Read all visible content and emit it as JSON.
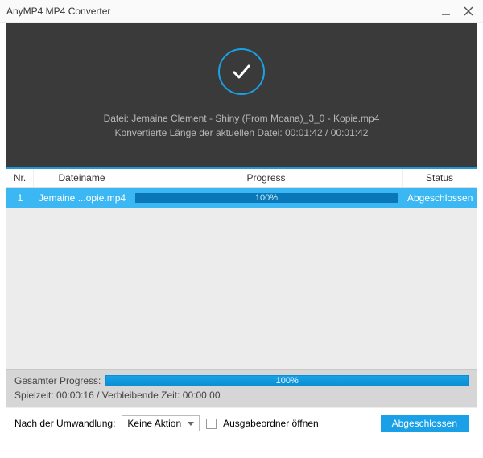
{
  "app_title": "AnyMP4 MP4 Converter",
  "hero": {
    "file_line": "Datei: Jemaine Clement - Shiny (From Moana)_3_0 - Kopie.mp4",
    "length_line": "Konvertierte Länge der aktuellen Datei: 00:01:42 / 00:01:42"
  },
  "table": {
    "headers": {
      "nr": "Nr.",
      "name": "Dateiname",
      "progress": "Progress",
      "status": "Status"
    },
    "rows": [
      {
        "nr": "1",
        "name": "Jemaine ...opie.mp4",
        "percent": "100%",
        "status": "Abgeschlossen"
      }
    ]
  },
  "summary": {
    "total_label": "Gesamter Progress:",
    "total_percent": "100%",
    "time_line": "Spielzeit: 00:00:16 / Verbleibende Zeit: 00:00:00"
  },
  "footer": {
    "after_label": "Nach der Umwandlung:",
    "action_selected": "Keine Aktion",
    "open_folder_label": "Ausgabeordner öffnen",
    "done_button": "Abgeschlossen"
  }
}
